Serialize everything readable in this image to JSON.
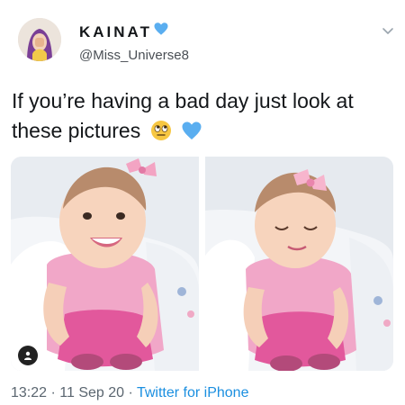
{
  "user": {
    "display_name": "KAINAT",
    "handle": "@Miss_Universe8",
    "verified_icon": "blue-heart-emoji",
    "avatar_icon": "profile-avatar"
  },
  "tweet": {
    "line1": "If you’re having a bad day just look at",
    "line2": "these pictures",
    "emojis": [
      "rolling-eyes-emoji",
      "blue-heart-emoji"
    ]
  },
  "media": {
    "photos": [
      {
        "name": "baby-photo-smiling"
      },
      {
        "name": "baby-photo-looking-down"
      }
    ],
    "badge_icon": "person-icon"
  },
  "meta": {
    "time": "13:22",
    "sep1": " · ",
    "date": "11 Sep 20",
    "sep2": " · ",
    "source": "Twitter for iPhone"
  },
  "colors": {
    "link": "#1b8fe0",
    "text": "#14171a",
    "secondary": "#5b6670",
    "blue_heart": "#5aaef0"
  }
}
